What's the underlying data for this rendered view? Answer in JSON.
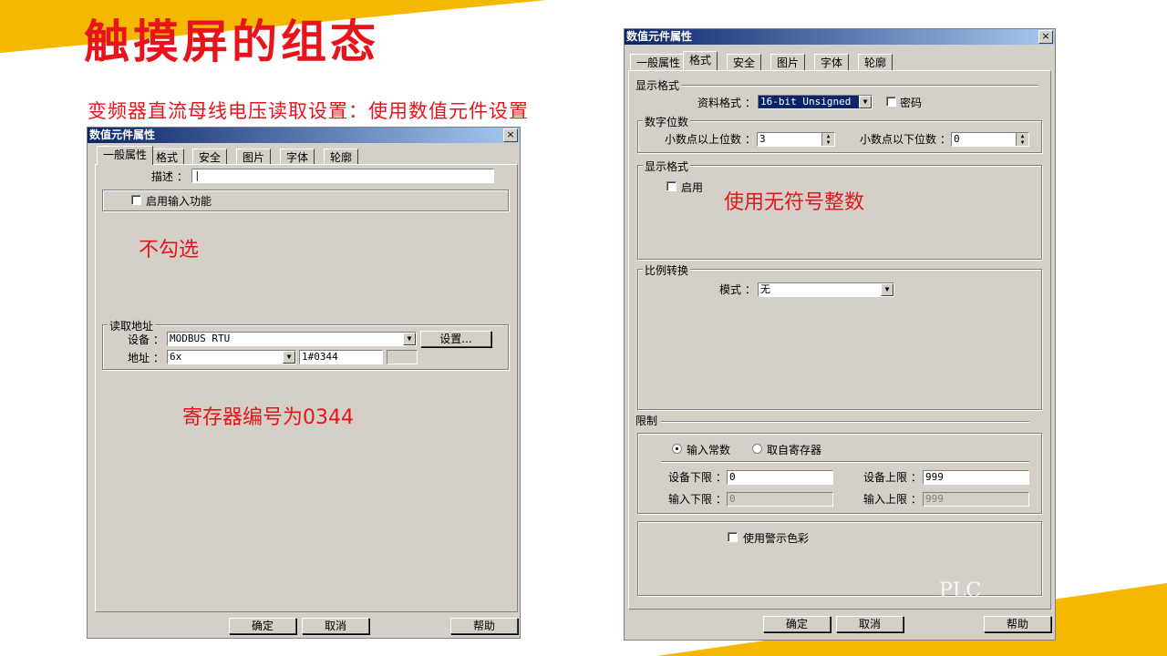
{
  "slide": {
    "title": "触摸屏的组态",
    "subtitle": "变频器直流母线电压读取设置：使用数值元件设置",
    "note_unchecked": "不勾选",
    "note_register": "寄存器编号为0344",
    "note_unsigned": "使用无符号整数",
    "watermark": "PLC"
  },
  "colors": {
    "accent_red": "#e8141b",
    "stripe_yellow": "#f5b800",
    "titlebar": "#0a246a"
  },
  "left_dialog": {
    "title": "数值元件属性",
    "close": "×",
    "tabs": [
      "一般属性",
      "格式",
      "安全",
      "图片",
      "字体",
      "轮廓"
    ],
    "desc_label": "描述 ：",
    "desc_value": "|",
    "enable_input_label": "启用输入功能",
    "read_address_group": "读取地址",
    "device_label": "设备 ：",
    "device_value": "MODBUS RTU",
    "settings_button": "设置...",
    "address_label": "地址 ：",
    "address_type": "6x",
    "address_value": "1#0344",
    "ok": "确定",
    "cancel": "取消",
    "help": "帮助"
  },
  "right_dialog": {
    "title": "数值元件属性",
    "close": "×",
    "tabs": [
      "一般属性",
      "格式",
      "安全",
      "图片",
      "字体",
      "轮廓"
    ],
    "display_format_section": "显示格式",
    "data_format_label": "资料格式 ：",
    "data_format_value": "16-bit Unsigned",
    "password_label": "密码",
    "digits_group": "数字位数",
    "int_digits_label": "小数点以上位数 ：",
    "int_digits_value": "3",
    "frac_digits_label": "小数点以下位数 ：",
    "frac_digits_value": "0",
    "display_format_group": "显示格式",
    "enable_label": "启用",
    "scaling_group": "比例转换",
    "mode_label": "模式 ：",
    "mode_value": "无",
    "limits_section": "限制",
    "input_constant_label": "输入常数",
    "from_register_label": "取自寄存器",
    "dev_low_label": "设备下限 ：",
    "dev_low_value": "0",
    "dev_high_label": "设备上限 ：",
    "dev_high_value": "999",
    "in_low_label": "输入下限 ：",
    "in_low_value": "0",
    "in_high_label": "输入上限 ：",
    "in_high_value": "999",
    "warn_color_label": "使用警示色彩",
    "ok": "确定",
    "cancel": "取消",
    "help": "帮助"
  }
}
